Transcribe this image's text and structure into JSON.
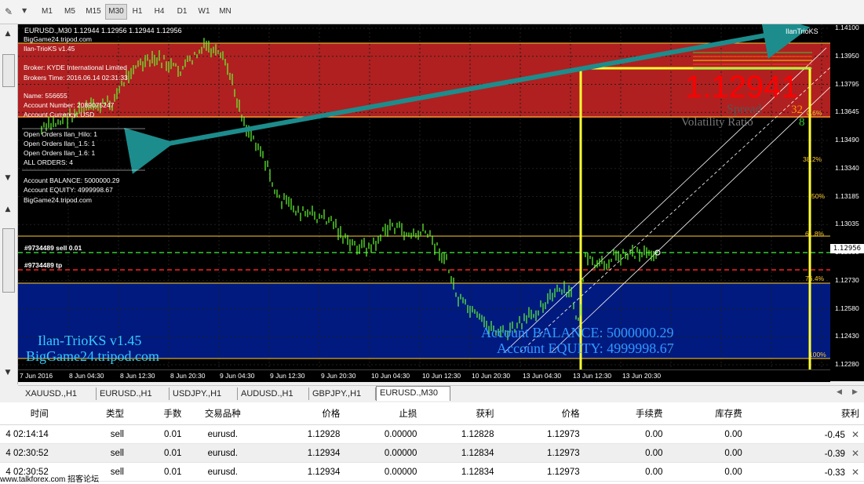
{
  "toolbar": {
    "timeframes": [
      "M1",
      "M5",
      "M15",
      "M30",
      "H1",
      "H4",
      "D1",
      "W1",
      "MN"
    ],
    "active": "M30"
  },
  "chart": {
    "header": "EURUSD.,M30  1.12944 1.12956 1.12944 1.12956",
    "indicator_name": "IlanTrioKS",
    "info_lines": [
      "BigGame24.tripod.com",
      "Ilan-TrioKS v1.45",
      "Broker:          KYDE International Limited",
      "Brokers Time:  2016.06.14 02:31:33",
      "Name:            556655",
      "Account Number:   2089075247",
      "Account Currency:   USD",
      "Open Orders Ilan_Hilo:   1",
      "Open Orders Ilan_1.5:    1",
      "Open Orders Ilan_1.6:    1",
      "ALL ORDERS:               4",
      "Account BALANCE:     5000000.29",
      "Account EQUITY:      4999998.67",
      "BigGame24.tripod.com"
    ],
    "big_price": "1.12941",
    "spread_label": "Spread",
    "spread_value": "32",
    "volatility_label": "Volatility Ratio",
    "volatility_value": "8",
    "balance_text": "Account BALANCE:  5000000.29",
    "equity_text": "Account EQUITY:  4999998.67",
    "watermark_1": "Ilan-TrioKS v1.45",
    "watermark_2": "BigGame24.tripod.com",
    "order_sell_label": "#9734489 sell 0.01",
    "order_tp_label": "#9734489 tp",
    "fib_levels": [
      "0.6%",
      "38.2%",
      "50%",
      "61.8%",
      "76.4%",
      "100%"
    ],
    "price_axis": [
      "1.14100",
      "1.13950",
      "1.13795",
      "1.13645",
      "1.13490",
      "1.13340",
      "1.13185",
      "1.13035",
      "1.12880",
      "1.12730",
      "1.12580",
      "1.12430",
      "1.12280"
    ],
    "current_price_tag": "1.12956",
    "time_axis": [
      "7 Jun 2016",
      "8 Jun 04:30",
      "8 Jun 12:30",
      "8 Jun 20:30",
      "9 Jun 04:30",
      "9 Jun 12:30",
      "9 Jun 20:30",
      "10 Jun 04:30",
      "10 Jun 12:30",
      "10 Jun 20:30",
      "13 Jun 04:30",
      "13 Jun 12:30",
      "13 Jun 20:30"
    ],
    "colors": {
      "red_zone": "#b02020",
      "blue_zone": "#001a80",
      "candle": "#66ff33",
      "yellow": "#ffff33",
      "arrow": "#1d8c8c",
      "big_price": "#ff0000"
    }
  },
  "tabs": [
    "XAUUSD.,H1",
    "EURUSD.,H1",
    "USDJPY.,H1",
    "AUDUSD.,H1",
    "GBPJPY.,H1",
    "EURUSD.,M30"
  ],
  "active_tab": "EURUSD.,M30",
  "table": {
    "headers": [
      "时间",
      "类型",
      "手数",
      "交易品种",
      "价格",
      "止损",
      "获利",
      "价格",
      "手续费",
      "库存费",
      "获利"
    ],
    "rows": [
      [
        "4 02:14:14",
        "sell",
        "0.01",
        "eurusd.",
        "1.12928",
        "0.00000",
        "1.12828",
        "1.12973",
        "0.00",
        "0.00",
        "-0.45"
      ],
      [
        "4 02:30:52",
        "sell",
        "0.01",
        "eurusd.",
        "1.12934",
        "0.00000",
        "1.12834",
        "1.12973",
        "0.00",
        "0.00",
        "-0.39"
      ],
      [
        "4 02:30:52",
        "sell",
        "0.01",
        "eurusd.",
        "1.12934",
        "0.00000",
        "1.12834",
        "1.12973",
        "0.00",
        "0.00",
        "-0.33"
      ]
    ]
  },
  "footer": "www.talkforex.com 招客论坛"
}
